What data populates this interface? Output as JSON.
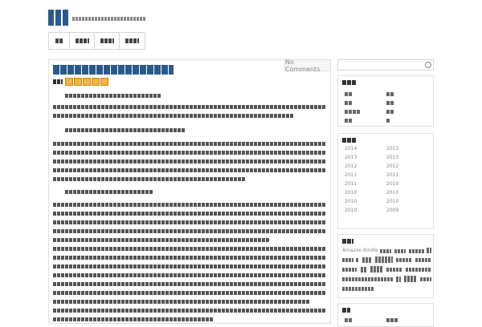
{
  "post": {
    "comments_label": "No Comments"
  },
  "archive_years": [
    "2014",
    "2013",
    "2013",
    "2013",
    "2012",
    "2012",
    "2011",
    "2011",
    "2011",
    "2010",
    "2010",
    "2010",
    "2010",
    "2010",
    "2010",
    "2009"
  ],
  "tags_widget": {
    "amazon_label": "Amazon Kindle"
  },
  "rating": {
    "stars_filled": 5,
    "stars_total": 5
  }
}
